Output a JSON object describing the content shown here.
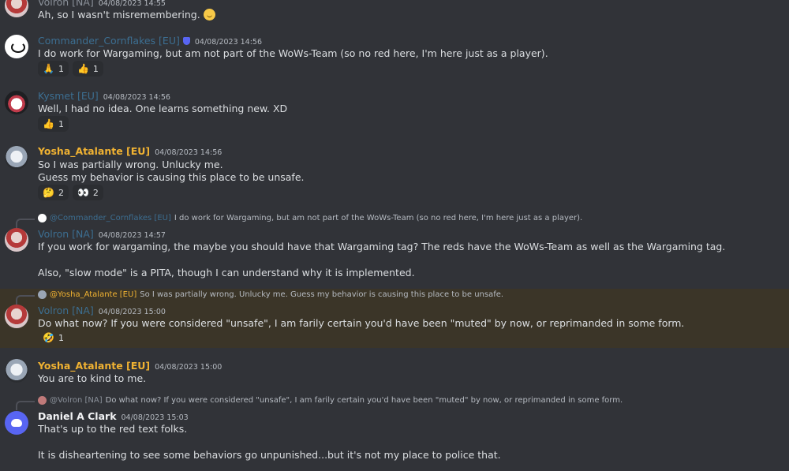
{
  "colors": {
    "background": "#313338",
    "highlight": "#3b3528",
    "blue_name": "#3e8ed0",
    "yellow_name": "#f0b232"
  },
  "messages": [
    {
      "author": "Volron [NA]",
      "timestamp": "04/08/2023 14:55",
      "lines": [
        "Ah, so I wasn't misremembering."
      ]
    },
    {
      "author": "Commander_Cornflakes [EU]",
      "timestamp": "04/08/2023 14:56",
      "lines": [
        "I do work for Wargaming, but am not part of the WoWs-Team (so no red here, I'm here just as a player)."
      ],
      "reactions": [
        {
          "emoji": "🙏",
          "count": "1"
        },
        {
          "emoji": "👍",
          "count": "1"
        }
      ]
    },
    {
      "author": "Kysmet [EU]",
      "timestamp": "04/08/2023 14:56",
      "lines": [
        "Well, I had no idea. One learns something new. XD"
      ],
      "reactions": [
        {
          "emoji": "👍",
          "count": "1"
        }
      ]
    },
    {
      "author": "Yosha_Atalante [EU]",
      "timestamp": "04/08/2023 14:56",
      "lines": [
        "So I was partially wrong. Unlucky me.",
        "Guess my behavior is causing this place to be unsafe."
      ],
      "reactions": [
        {
          "emoji": "🤔",
          "count": "2"
        },
        {
          "emoji": "👀",
          "count": "2"
        }
      ]
    },
    {
      "reply": {
        "author": "@Commander_Cornflakes [EU]",
        "text": "I do work for Wargaming, but am not part of the WoWs-Team (so no red here, I'm here just as a player)."
      },
      "author": "Volron [NA]",
      "timestamp": "04/08/2023 14:57",
      "lines": [
        "If you work for wargaming, the maybe you should have that Wargaming tag?  The reds have the WoWs-Team as well as the Wargaming tag.",
        "Also, \"slow mode\" is a PITA, though I can understand why it is implemented."
      ]
    },
    {
      "reply": {
        "author": "@Yosha_Atalante [EU]",
        "text": "So I was partially wrong. Unlucky me. Guess my behavior is causing this place to be unsafe."
      },
      "author": "Volron [NA]",
      "timestamp": "04/08/2023 15:00",
      "lines": [
        "Do what now?  If you were considered \"unsafe\", I am farily certain you'd have been \"muted\" by now, or reprimanded in some form."
      ],
      "reactions": [
        {
          "emoji": "🤣",
          "count": "1"
        }
      ]
    },
    {
      "author": "Yosha_Atalante [EU]",
      "timestamp": "04/08/2023 15:00",
      "lines": [
        "You are to kind to me."
      ]
    },
    {
      "reply": {
        "author": "@Volron [NA]",
        "text": "Do what now? If you were considered \"unsafe\", I am farily certain you'd have been \"muted\" by now, or reprimanded in some form."
      },
      "author": "Daniel A Clark",
      "timestamp": "04/08/2023 15:03",
      "lines": [
        "That's up to the red text folks.",
        "It is disheartening to see some behaviors go unpunished...but it's not my place to police that."
      ]
    }
  ]
}
